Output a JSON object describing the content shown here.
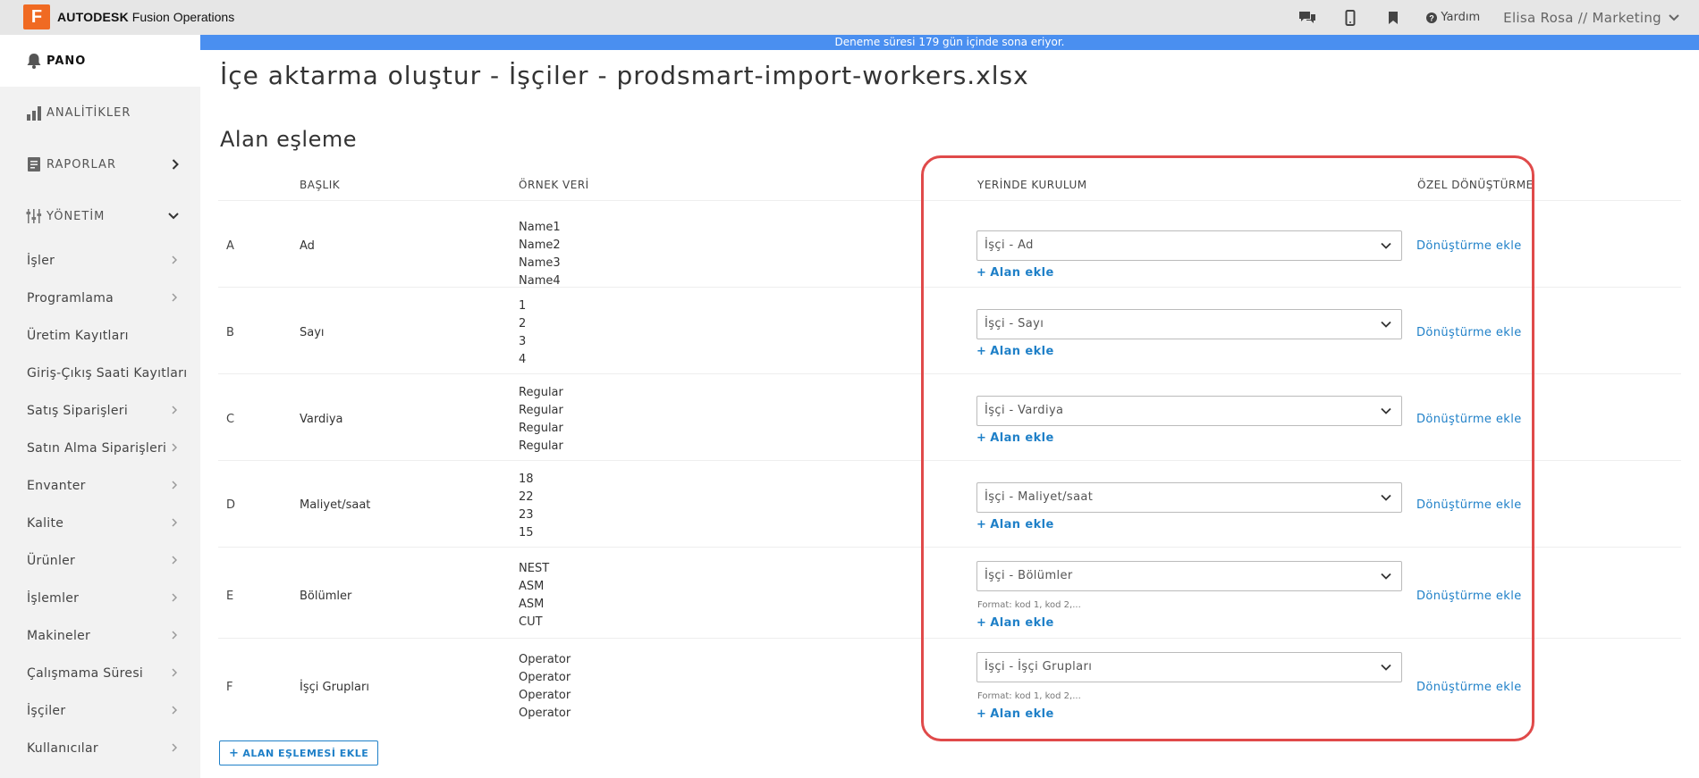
{
  "app": {
    "brand_bold": "AUTODESK",
    "brand_rest": "Fusion Operations",
    "logo_letter": "F",
    "accent": "#f06a22"
  },
  "topbar": {
    "help_label": "Yardım",
    "user_label": "Elisa Rosa // Marketing"
  },
  "banner": {
    "text": "Deneme süresi 179 gün içinde sona eriyor."
  },
  "sidebar": {
    "main": [
      {
        "label": "PANO",
        "icon": "bell-icon"
      },
      {
        "label": "ANALİTİKLER",
        "icon": "bar-chart-icon"
      },
      {
        "label": "RAPORLAR",
        "icon": "report-icon"
      },
      {
        "label": "YÖNETİM",
        "icon": "sliders-icon"
      }
    ],
    "sub": [
      {
        "label": "İşler",
        "chevron": true
      },
      {
        "label": "Programlama",
        "chevron": true
      },
      {
        "label": "Üretim Kayıtları",
        "chevron": false
      },
      {
        "label": "Giriş-Çıkış Saati Kayıtları",
        "chevron": false
      },
      {
        "label": "Satış Siparişleri",
        "chevron": true
      },
      {
        "label": "Satın Alma Siparişleri",
        "chevron": true
      },
      {
        "label": "Envanter",
        "chevron": true
      },
      {
        "label": "Kalite",
        "chevron": true
      },
      {
        "label": "Ürünler",
        "chevron": true
      },
      {
        "label": "İşlemler",
        "chevron": true
      },
      {
        "label": "Makineler",
        "chevron": true
      },
      {
        "label": "Çalışmama Süresi",
        "chevron": true
      },
      {
        "label": "İşçiler",
        "chevron": true
      },
      {
        "label": "Kullanıcılar",
        "chevron": true
      }
    ]
  },
  "main": {
    "page_title": "İçe aktarma oluştur - İşçiler - prodsmart-import-workers.xlsx",
    "section_title": "Alan eşleme",
    "columns": {
      "header": "BAŞLIK",
      "sample": "ÖRNEK VERİ",
      "on_premise": "YERİNDE KURULUM",
      "custom_transform": "ÖZEL DÖNÜŞTÜRME"
    },
    "add_field_label": "Alan ekle",
    "transform_label": "Dönüştürme ekle",
    "add_mapping_label": "ALAN EŞLEMESİ EKLE",
    "rows": [
      {
        "letter": "A",
        "header": "Ad",
        "samples": "Name1\nName2\nName3\nName4",
        "select": "İşçi - Ad",
        "format": ""
      },
      {
        "letter": "B",
        "header": "Sayı",
        "samples": "1\n2\n3\n4",
        "select": "İşçi - Sayı",
        "format": ""
      },
      {
        "letter": "C",
        "header": "Vardiya",
        "samples": "Regular\nRegular\nRegular\nRegular",
        "select": "İşçi - Vardiya",
        "format": ""
      },
      {
        "letter": "D",
        "header": "Maliyet/saat",
        "samples": "18\n22\n23\n15",
        "select": "İşçi - Maliyet/saat",
        "format": ""
      },
      {
        "letter": "E",
        "header": "Bölümler",
        "samples": "NEST\nASM\nASM\nCUT",
        "select": "İşçi - Bölümler",
        "format": "Format: kod 1, kod 2,..."
      },
      {
        "letter": "F",
        "header": "İşçi Grupları",
        "samples": "Operator\nOperator\nOperator\nOperator",
        "select": "İşçi - İşçi Grupları",
        "format": "Format: kod 1, kod 2,..."
      }
    ]
  },
  "colors": {
    "link": "#1f80c8",
    "banner": "#4a8ff0",
    "highlight": "#e04a4a"
  }
}
